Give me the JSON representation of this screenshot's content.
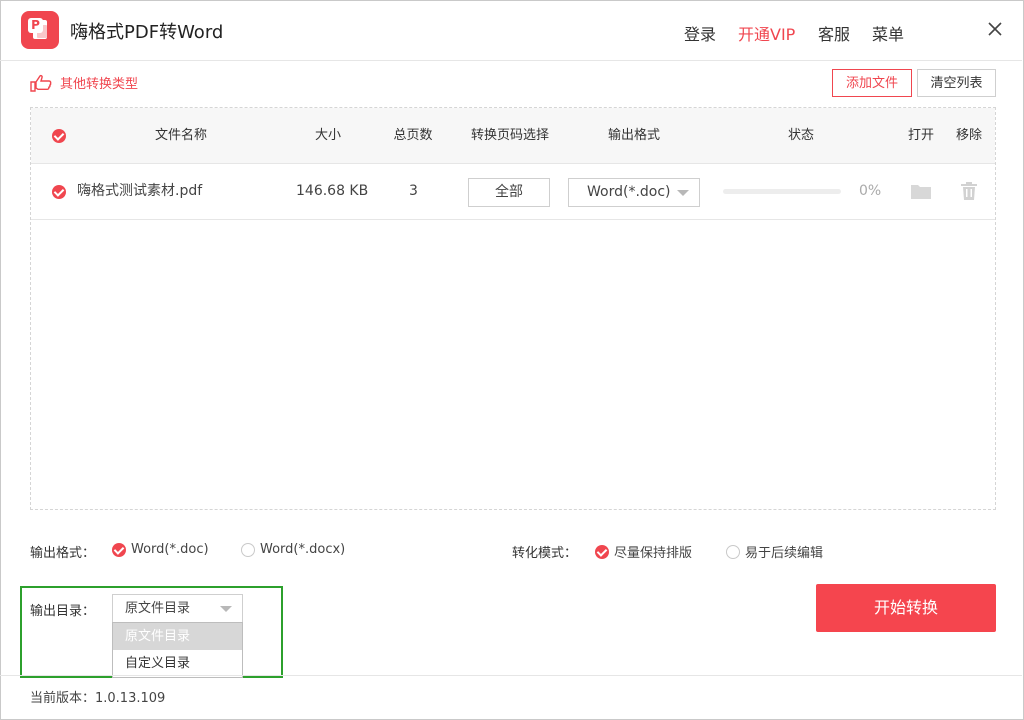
{
  "app": {
    "title": "嗨格式PDF转Word",
    "logo_letter": "P"
  },
  "top_nav": {
    "login": "登录",
    "vip": "开通VIP",
    "service": "客服",
    "menu": "菜单"
  },
  "toolbar": {
    "other_types": "其他转换类型",
    "add_file": "添加文件",
    "clear_list": "清空列表"
  },
  "table": {
    "headers": {
      "name": "文件名称",
      "size": "大小",
      "pages": "总页数",
      "page_select": "转换页码选择",
      "format": "输出格式",
      "status": "状态",
      "open": "打开",
      "remove": "移除"
    },
    "rows": [
      {
        "name": "嗨格式测试素材.pdf",
        "size": "146.68 KB",
        "pages": "3",
        "page_select": "全部",
        "format": "Word(*.doc)",
        "progress": 0,
        "progress_text": "0%"
      }
    ]
  },
  "options": {
    "format_label": "输出格式：",
    "format_options": [
      "Word(*.doc)",
      "Word(*.docx)"
    ],
    "format_selected": 0,
    "mode_label": "转化模式：",
    "mode_options": [
      "尽量保持排版",
      "易于后续编辑"
    ],
    "mode_selected": 0
  },
  "output_dir": {
    "label": "输出目录：",
    "value": "原文件目录",
    "options": [
      "原文件目录",
      "自定义目录"
    ],
    "highlighted": 0
  },
  "start_button": "开始转换",
  "footer": {
    "version": "当前版本：1.0.13.109"
  },
  "colors": {
    "accent": "#f0464f",
    "highlight_border": "#2ca02c"
  }
}
